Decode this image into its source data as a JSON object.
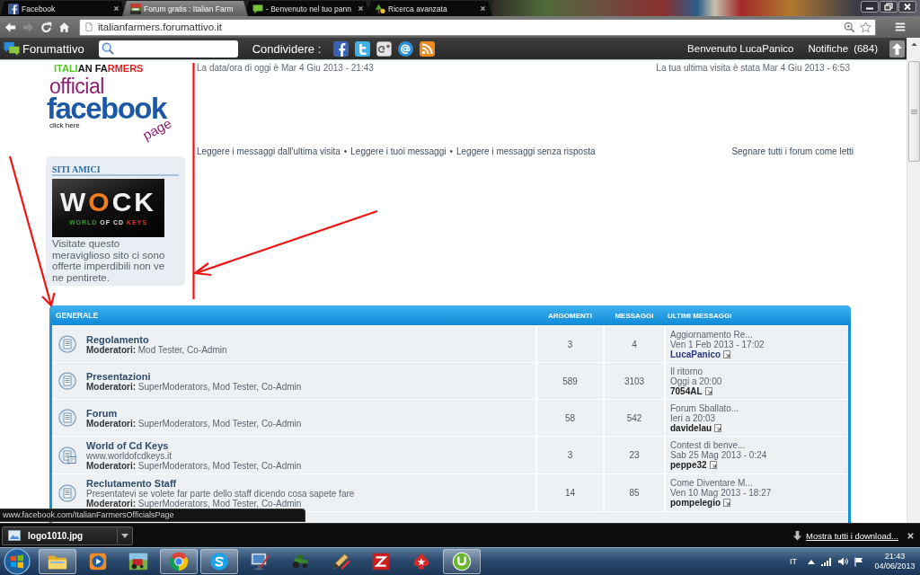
{
  "browser": {
    "tabs": [
      {
        "kind": "facebook",
        "label": "Facebook",
        "selected": false,
        "closable": true
      },
      {
        "kind": "picture",
        "label": "Forum gratis : Italian Farm",
        "selected": true,
        "closable": false
      },
      {
        "kind": "chat",
        "label": "- Benvenuto nel tuo pann",
        "selected": false,
        "closable": true
      },
      {
        "kind": "tree",
        "label": "Ricerca avanzata",
        "selected": false,
        "closable": true
      }
    ],
    "nav_buttons": [
      {
        "kind": "back",
        "disabled": false
      },
      {
        "kind": "forward",
        "disabled": true
      },
      {
        "kind": "reload",
        "disabled": false
      },
      {
        "kind": "home",
        "disabled": false
      }
    ],
    "address_bar": {
      "url": "italianfarmers.forumattivo.it"
    }
  },
  "forum_toolbar": {
    "brand": "Forumattivo",
    "share_label": "Condividere :",
    "share_buttons": [
      {
        "kind": "facebook"
      },
      {
        "kind": "twitter"
      },
      {
        "kind": "google-plus"
      },
      {
        "kind": "email"
      },
      {
        "kind": "rss"
      }
    ],
    "welcome": "Benvenuto LucaPanico",
    "notifications": "Notifiche",
    "notifications_count": "(684)"
  },
  "sidebar": {
    "banner": {
      "line_1": "ITALIAN FARMERS",
      "line_2": "official",
      "line_3": "facebook",
      "line_4": "click here",
      "line_5": "page"
    },
    "friends_box": {
      "title": "SITI AMICI",
      "banner": {
        "title": "WOCK",
        "subtitle": "WORLD OF CD KEYS"
      },
      "text": "Visitate questo meraviglioso sito ci sono offerte imperdibili non ve ne pentirete."
    }
  },
  "info_bar": {
    "current_time": "La data/ora di oggi è Mar 4 Giu 2013 - 21:43",
    "last_visit": "La tua ultima visita è stata Mar 4 Giu 2013 - 6:53"
  },
  "quick_links": {
    "items": [
      "Leggere i messaggi dall'ultima visita",
      "Leggere i tuoi messaggi",
      "Leggere i messaggi senza risposta"
    ],
    "separators": [
      "•",
      "•"
    ],
    "mark_all_read": "Segnare tutti i forum come letti"
  },
  "forum_table": {
    "category": "GENERALE",
    "columns": [
      "ARGOMENTI",
      "MESSAGGI",
      "ULTIMI MESSAGGI"
    ],
    "rows": [
      {
        "kind": "forum",
        "title": "Regolamento",
        "moderators": "**Moderatori:** Mod Tester, Co-Admin",
        "topics": "3",
        "posts": "4",
        "last_post": {
          "title": "Aggiornamento Re...",
          "date": "Ven 1 Feb 2013 - 17:02",
          "user": "LucaPanico",
          "color": "#27367f"
        }
      },
      {
        "kind": "forum",
        "title": "Presentazioni",
        "moderators": "**Moderatori:** SuperModerators, Mod Tester, Co-Admin",
        "topics": "589",
        "posts": "3103",
        "last_post": {
          "title": "Il ritorno",
          "date": "Oggi a 20:00",
          "user": "7054AL",
          "color": "#222222"
        }
      },
      {
        "kind": "forum",
        "title": "Forum",
        "moderators": "**Moderatori:** SuperModerators, Mod Tester, Co-Admin",
        "topics": "58",
        "posts": "542",
        "last_post": {
          "title": "Forum Sballato...",
          "date": "Ieri a 20:03",
          "user": "davidelau",
          "color": "#222222"
        }
      },
      {
        "kind": "link",
        "title": "World of Cd Keys",
        "description": "www.worldofcdkeys.it",
        "moderators": "**Moderatori:** SuperModerators, Mod Tester, Co-Admin",
        "topics": "3",
        "posts": "23",
        "last_post": {
          "title": "Contest di benve...",
          "date": "Sab 25 Mag 2013 - 0:24",
          "user": "peppe32",
          "color": "#222222"
        }
      },
      {
        "kind": "forum",
        "title": "Reclutamento Staff",
        "description": "Presentatevi se volete far parte dello staff dicendo cosa sapete fare",
        "moderators": "**Moderatori:** SuperModerators, Mod Tester, Co-Admin",
        "topics": "14",
        "posts": "85",
        "last_post": {
          "title": "Come Diventare M...",
          "date": "Ven 10 Mag 2013 - 18:27",
          "user": "pompelegio",
          "color": "#222222"
        }
      }
    ]
  },
  "status_url": "www.facebook.com/ItalianFarmersOfficialsPage",
  "downloads_bar": {
    "items": [
      {
        "filename": "logo1010.jpg"
      }
    ],
    "show_all": "Mostra tutti i download..."
  },
  "taskbar": {
    "apps": [
      {
        "kind": "folder",
        "running": true
      },
      {
        "kind": "media-player",
        "running": false
      },
      {
        "kind": "game",
        "running": false
      },
      {
        "kind": "browser",
        "running": true
      },
      {
        "kind": "messenger",
        "running": true
      },
      {
        "kind": "monitor",
        "running": false
      },
      {
        "kind": "tractor",
        "running": false
      },
      {
        "kind": "paint",
        "running": false
      },
      {
        "kind": "ftp",
        "running": false
      },
      {
        "kind": "spade",
        "running": false
      },
      {
        "kind": "torrent",
        "running": true
      }
    ],
    "language": "IT",
    "time": "21:43",
    "date": "04/06/2013"
  }
}
